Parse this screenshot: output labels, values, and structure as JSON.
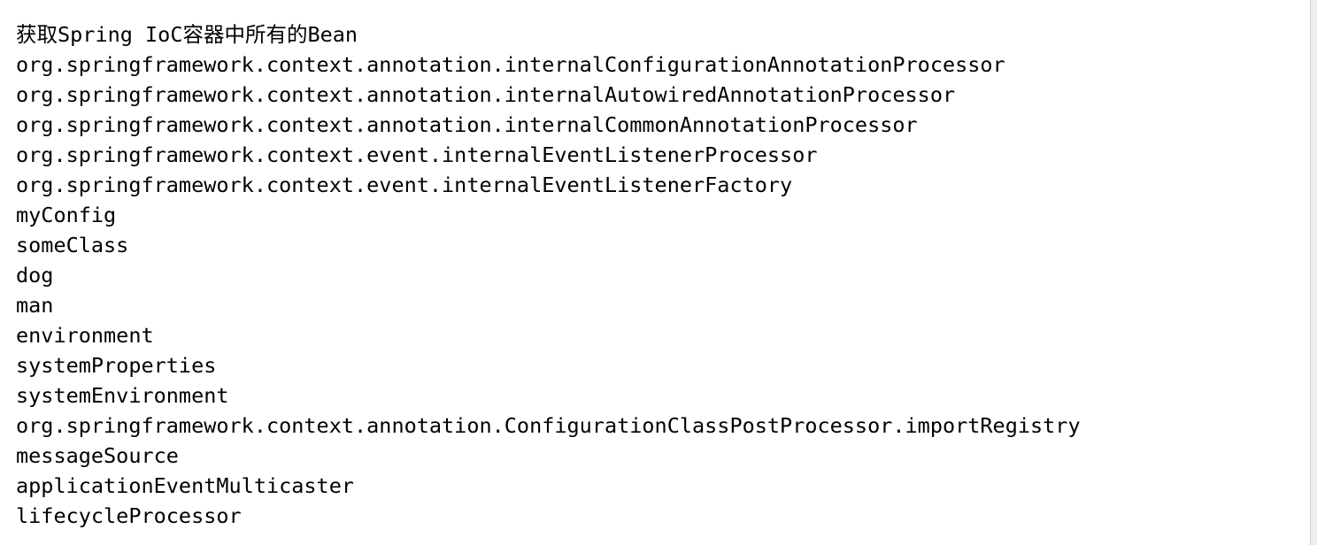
{
  "console": {
    "lines": [
      "获取Spring IoC容器中所有的Bean",
      "org.springframework.context.annotation.internalConfigurationAnnotationProcessor",
      "org.springframework.context.annotation.internalAutowiredAnnotationProcessor",
      "org.springframework.context.annotation.internalCommonAnnotationProcessor",
      "org.springframework.context.event.internalEventListenerProcessor",
      "org.springframework.context.event.internalEventListenerFactory",
      "myConfig",
      "someClass",
      "dog",
      "man",
      "environment",
      "systemProperties",
      "systemEnvironment",
      "org.springframework.context.annotation.ConfigurationClassPostProcessor.importRegistry",
      "messageSource",
      "applicationEventMulticaster",
      "lifecycleProcessor"
    ]
  },
  "colors": {
    "background": "#ffffff",
    "text": "#000000",
    "scroll_edge": "#eeeeee"
  }
}
